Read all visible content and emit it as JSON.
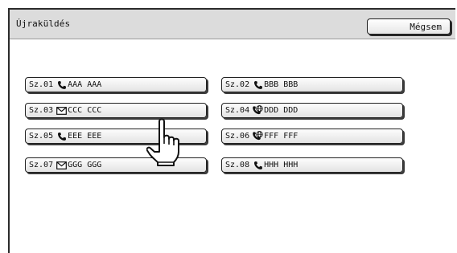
{
  "header": {
    "title": "Újraküldés",
    "cancel_label": "Mégsem"
  },
  "destinations": [
    {
      "number": "Sz.01",
      "icon": "phone-icon",
      "name": "AAA AAA"
    },
    {
      "number": "Sz.02",
      "icon": "phone-icon",
      "name": "BBB BBB"
    },
    {
      "number": "Sz.03",
      "icon": "envelope-icon",
      "name": "CCC CCC"
    },
    {
      "number": "Sz.04",
      "icon": "globe-phone-icon",
      "name": "DDD DDD"
    },
    {
      "number": "Sz.05",
      "icon": "phone-icon",
      "name": "EEE EEE"
    },
    {
      "number": "Sz.06",
      "icon": "globe-phone-icon",
      "name": "FFF FFF"
    },
    {
      "number": "Sz.07",
      "icon": "envelope-icon",
      "name": "GGG GGG"
    },
    {
      "number": "Sz.08",
      "icon": "phone-icon",
      "name": "HHH HHH"
    }
  ]
}
